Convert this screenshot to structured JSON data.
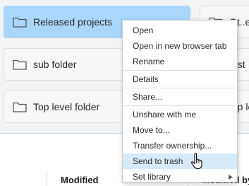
{
  "folders": [
    {
      "label": "Released projects",
      "selected": true
    },
    {
      "label": "sub folder",
      "selected": false
    },
    {
      "label": "Top level folder",
      "selected": false
    }
  ],
  "right_cards": [
    {
      "label": "Ot..er"
    },
    {
      "label": "...st"
    },
    {
      "label": "...p le"
    }
  ],
  "table_headers": {
    "col1": "Modified",
    "col2": "Modified by"
  },
  "context_menu": {
    "items": [
      {
        "label": "Open"
      },
      {
        "label": "Open in new browser tab"
      },
      {
        "label": "Rename"
      },
      {
        "label": "Details"
      },
      {
        "label": "Share..."
      },
      {
        "label": "Unshare with me"
      },
      {
        "label": "Move to..."
      },
      {
        "label": "Transfer ownership..."
      },
      {
        "label": "Send to trash",
        "hovered": true
      },
      {
        "label": "Set library",
        "submenu": true
      }
    ]
  },
  "icons": {
    "folder": "folder-icon",
    "submenu": "chevron-right-icon",
    "cursor": "hand-pointer-icon"
  },
  "colors": {
    "selected_card": "#a8d7fb",
    "menu_hover": "#d7eaf9",
    "grid_background": "#f2f3f5"
  }
}
